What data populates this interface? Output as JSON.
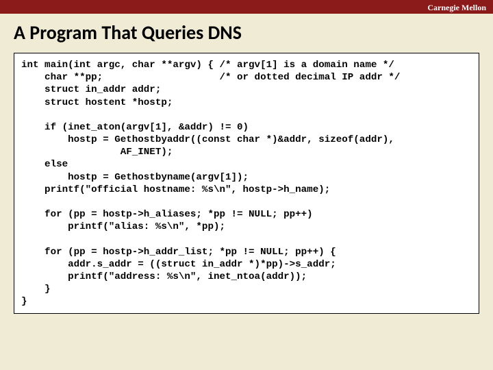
{
  "header": {
    "institution": "Carnegie Mellon"
  },
  "slide": {
    "title": "A Program That Queries DNS"
  },
  "code": {
    "text": "int main(int argc, char **argv) { /* argv[1] is a domain name */\n    char **pp;                    /* or dotted decimal IP addr */\n    struct in_addr addr;\n    struct hostent *hostp;\n\n    if (inet_aton(argv[1], &addr) != 0)\n        hostp = Gethostbyaddr((const char *)&addr, sizeof(addr),\n                 AF_INET);\n    else\n        hostp = Gethostbyname(argv[1]);\n    printf(\"official hostname: %s\\n\", hostp->h_name);\n\n    for (pp = hostp->h_aliases; *pp != NULL; pp++)\n        printf(\"alias: %s\\n\", *pp);\n\n    for (pp = hostp->h_addr_list; *pp != NULL; pp++) {\n        addr.s_addr = ((struct in_addr *)*pp)->s_addr;\n        printf(\"address: %s\\n\", inet_ntoa(addr));\n    }\n}"
  }
}
